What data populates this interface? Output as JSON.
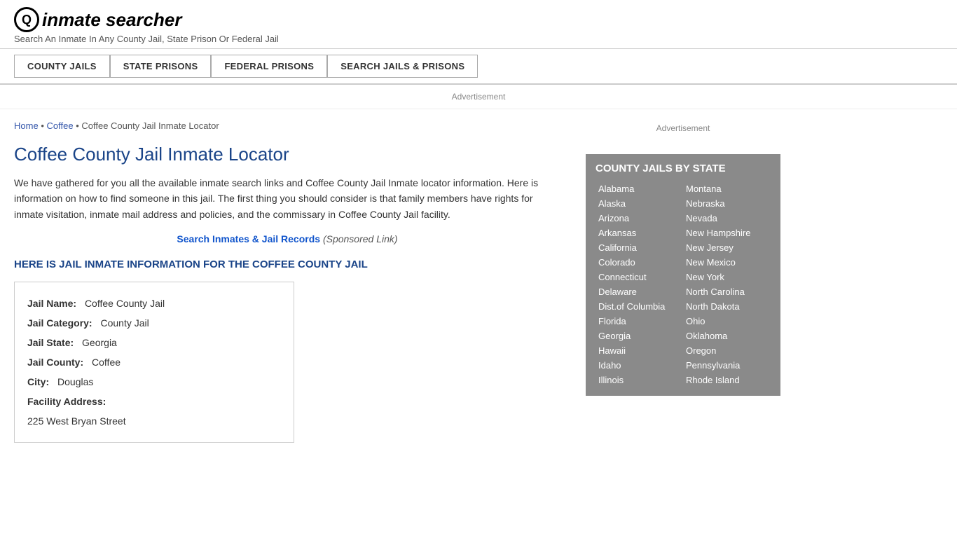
{
  "header": {
    "logo_icon": "Q",
    "logo_text": "inmate searcher",
    "tagline": "Search An Inmate In Any County Jail, State Prison Or Federal Jail"
  },
  "nav": {
    "items": [
      {
        "label": "COUNTY JAILS",
        "name": "county-jails"
      },
      {
        "label": "STATE PRISONS",
        "name": "state-prisons"
      },
      {
        "label": "FEDERAL PRISONS",
        "name": "federal-prisons"
      },
      {
        "label": "SEARCH JAILS & PRISONS",
        "name": "search-jails-prisons"
      }
    ]
  },
  "ad_label": "Advertisement",
  "breadcrumb": {
    "home": "Home",
    "county": "Coffee",
    "current": "Coffee County Jail Inmate Locator"
  },
  "page_title": "Coffee County Jail Inmate Locator",
  "description": "We have gathered for you all the available inmate search links and Coffee County Jail Inmate locator information. Here is information on how to find someone in this jail. The first thing you should consider is that family members have rights for inmate visitation, inmate mail address and policies, and the commissary in Coffee County Jail facility.",
  "search_link": {
    "text": "Search Inmates & Jail Records",
    "sponsored": "(Sponsored Link)"
  },
  "section_heading": "HERE IS JAIL INMATE INFORMATION FOR THE COFFEE COUNTY JAIL",
  "info_box": {
    "rows": [
      {
        "label": "Jail Name:",
        "value": "Coffee County Jail"
      },
      {
        "label": "Jail Category:",
        "value": "County Jail"
      },
      {
        "label": "Jail State:",
        "value": "Georgia"
      },
      {
        "label": "Jail County:",
        "value": "Coffee"
      },
      {
        "label": "City:",
        "value": "Douglas"
      },
      {
        "label": "Facility Address:",
        "value": ""
      },
      {
        "label": "",
        "value": "225 West Bryan Street"
      }
    ]
  },
  "sidebar": {
    "ad_label": "Advertisement",
    "state_box_title": "COUNTY JAILS BY STATE",
    "states_col1": [
      "Alabama",
      "Alaska",
      "Arizona",
      "Arkansas",
      "California",
      "Colorado",
      "Connecticut",
      "Delaware",
      "Dist.of Columbia",
      "Florida",
      "Georgia",
      "Hawaii",
      "Idaho",
      "Illinois"
    ],
    "states_col2": [
      "Montana",
      "Nebraska",
      "Nevada",
      "New Hampshire",
      "New Jersey",
      "New Mexico",
      "New York",
      "North Carolina",
      "North Dakota",
      "Ohio",
      "Oklahoma",
      "Oregon",
      "Pennsylvania",
      "Rhode Island"
    ]
  }
}
